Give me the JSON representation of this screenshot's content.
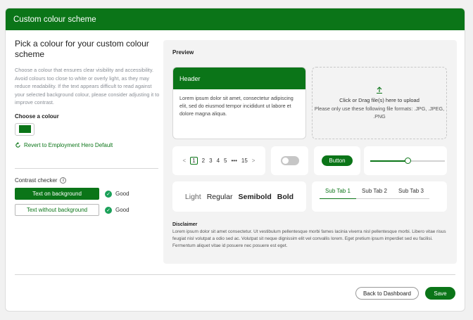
{
  "window": {
    "title": "Custom colour scheme"
  },
  "left": {
    "heading": "Pick a colour for your custom colour scheme",
    "description": "Choose a colour that ensures clear visibility and accessibility. Avoid colours too close to white or overly light, as they may reduce readability. If the text appears difficult to read against your selected background colour, please consider adjusting it to improve contrast.",
    "choose_label": "Choose a colour",
    "selected_colour": "#0b7518",
    "revert_label": "Revert to Employment Hero Default"
  },
  "contrast": {
    "title": "Contrast checker",
    "rows": [
      {
        "label": "Text on background",
        "status": "Good"
      },
      {
        "label": "Text without background",
        "status": "Good"
      }
    ]
  },
  "preview": {
    "title": "Preview",
    "header_card": {
      "header": "Header",
      "body": "Lorem ipsum dolor sit amet, consectetur adipiscing elit, sed do eiusmod tempor incididunt ut labore et dolore magna aliqua."
    },
    "upload": {
      "line1": "Click or Drag file(s) here to upload",
      "line2": "Please only use these following file formats: .JPG, .JPEG, .PNG"
    },
    "pagination": {
      "prev": "<",
      "pages": [
        "1",
        "2",
        "3",
        "4",
        "5",
        "•••",
        "15"
      ],
      "next": ">",
      "current": "1"
    },
    "toggle_state": "off",
    "button_label": "Button",
    "slider_value": 0.5,
    "font_weights": [
      "Light",
      "Regular",
      "Semibold",
      "Bold"
    ],
    "tabs": [
      "Sub Tab 1",
      "Sub Tab 2",
      "Sub Tab 3"
    ],
    "active_tab": "Sub Tab 1",
    "disclaimer_title": "Disclaimer",
    "disclaimer_text": "Lorem ipsum dolor sit amet consectetur. Ut vestibulum pellentesque morbi fames lacinia viverra nisl pellentesque morbi. Libero vitae risus feugiat nisl volutpat a odio sed ac. Volutpat sit neque dignissim elit vel convallis lorem. Eget pretium ipsum imperdiet sed eu facilisi. Fermentum aliquet vitae id posuere nec posuere est eget."
  },
  "footer": {
    "back_label": "Back to Dashboard",
    "save_label": "Save"
  },
  "colors": {
    "brand": "#0b7518",
    "good": "#1aa058"
  }
}
